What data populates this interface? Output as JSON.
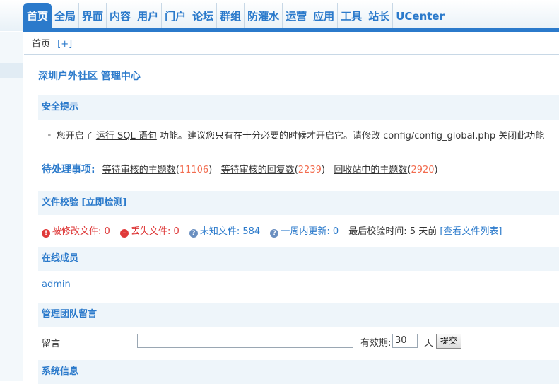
{
  "nav": {
    "items": [
      "首页",
      "全局",
      "界面",
      "内容",
      "用户",
      "门户",
      "论坛",
      "群组",
      "防灌水",
      "运营",
      "应用",
      "工具",
      "站长",
      "UCenter"
    ],
    "active_index": 0
  },
  "breadcrumb": {
    "home": "首页",
    "add": "[+]"
  },
  "page_title": "深圳户外社区 管理中心",
  "security": {
    "title": "安全提示",
    "text_before": "您开启了",
    "link": "运行 SQL 语句",
    "text_after": "功能。建议您只有在十分必要的时候才开启它。请修改 config/config_global.php 关闭此功能"
  },
  "todo": {
    "label": "待处理事项:",
    "items": [
      {
        "label": "等待审核的主题数",
        "count": "11106"
      },
      {
        "label": "等待审核的回复数",
        "count": "2239"
      },
      {
        "label": "回收站中的主题数",
        "count": "2920"
      }
    ]
  },
  "filecheck": {
    "title": "文件校验",
    "action": "[立即检测]",
    "modified": "被修改文件: 0",
    "missing": "丢失文件: 0",
    "unknown": "未知文件: 584",
    "week": "一周内更新: 0",
    "last_check_label": "最后校验时间: 5 天前",
    "list_link": "[查看文件列表]"
  },
  "online": {
    "title": "在线成员",
    "members": [
      "admin"
    ]
  },
  "team_message": {
    "title": "管理团队留言",
    "label": "留言",
    "message_value": "",
    "expire_label": "有效期:",
    "days": "30",
    "unit": "天",
    "submit": "提交"
  },
  "system": {
    "title": "系统信息"
  },
  "colors": {
    "accent": "#2b7acb",
    "count": "#f26c4f",
    "section_bg": "#eef5fa"
  },
  "icons": {
    "modified": "error-icon",
    "missing": "minus-circle-icon",
    "unknown": "help-icon",
    "week": "help-icon"
  }
}
